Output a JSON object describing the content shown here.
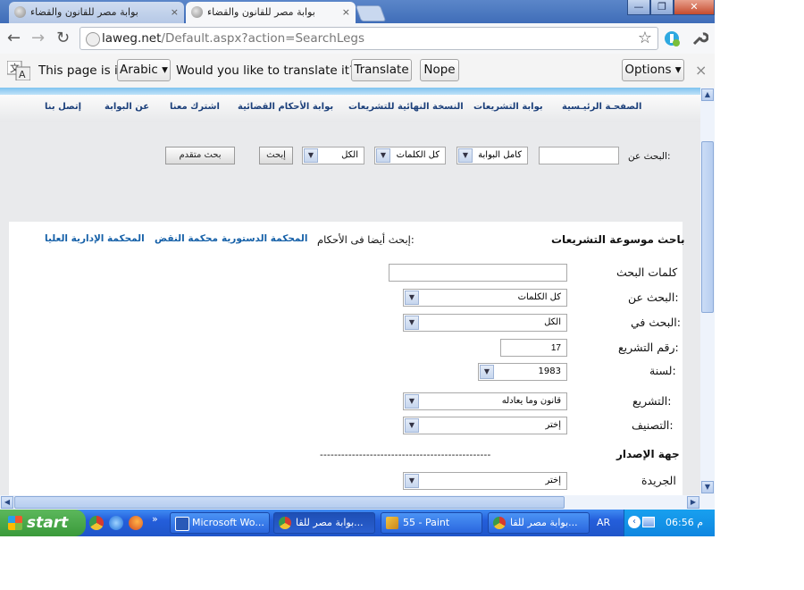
{
  "browser": {
    "tabs": [
      {
        "title": "بوابة مصر للقانون والقضاء",
        "active": false
      },
      {
        "title": "بوابة مصر للقانون والقضاء",
        "active": true
      }
    ],
    "close_glyph": "×",
    "window_buttons": {
      "minimize": "—",
      "restore": "❐",
      "close": "✕"
    },
    "url_host": "laweg.net",
    "url_path": "/Default.aspx?action=SearchLegs"
  },
  "translate_bar": {
    "prefix": "This page is in",
    "language": "Arabic",
    "question": "Would you like to translate it?",
    "translate_button": "Translate",
    "nope_button": "Nope",
    "options_button": "Options"
  },
  "site_menu": [
    "الصفحـة الرئيـسية",
    "بوابة التشريعات",
    "النسخة النهائية للتشريعات",
    "بوابة الأحكام القضائية",
    "اشترك معنا",
    "عن البوابة",
    "إتصل بنا"
  ],
  "quick_search": {
    "label": "البحث عن:",
    "input_value": "",
    "scope": "كامل البوابة",
    "words": "كل الكلمات",
    "category": "الكل",
    "search_button": "إبحث",
    "advanced_button": "بحث متقدم"
  },
  "panel": {
    "title": "باحث موسوعة التشريعات",
    "also_search_label": "إبحث أيضا فى الأحكام:",
    "court_links": [
      "المحكمة الدستورية",
      "محكمة النقض",
      "المحكمة الإدارية العليا"
    ],
    "fields": {
      "keywords_label": "كلمات البحث",
      "keywords_value": "",
      "search_for_label": "البحث عن:",
      "search_for_value": "كل الكلمات",
      "search_in_label": "البحث في:",
      "search_in_value": "الكل",
      "law_number_label": "رقم التشريع:",
      "law_number_value": "17",
      "year_label": "لسنة:",
      "year_value": "1983",
      "legislation_label": "التشريع:",
      "legislation_value": "قانون وما يعادله",
      "classification_label": "التصنيف:",
      "classification_value": "إختر",
      "issuer_heading": "جهة الإصدار",
      "issuer_dashes": "------------------------------------------------",
      "gazette_label": "الجريدة",
      "gazette_value": "إختر"
    }
  },
  "taskbar": {
    "start_label": "start",
    "overflow_glyph": "»",
    "tasks": [
      {
        "label": "Microsoft Wo...",
        "active": false
      },
      {
        "label": "بوابة مصر للقا...",
        "active": true
      },
      {
        "label": "55 - Paint",
        "active": false
      },
      {
        "label": "بوابة مصر للقا...",
        "active": false
      }
    ],
    "language": "AR",
    "clock": "06:56 م"
  },
  "colors": {
    "titlebar": "#3f6db8",
    "menu_link": "#1b3f7a",
    "court_link": "#1560a8",
    "taskbar": "#245edb",
    "start": "#3a9a3a"
  }
}
